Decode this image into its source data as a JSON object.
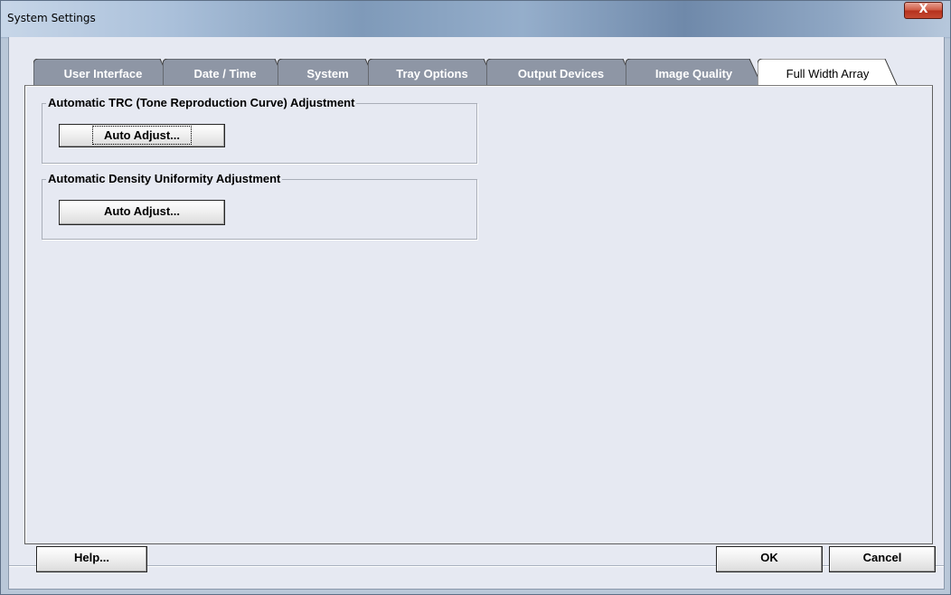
{
  "window": {
    "title": "System Settings",
    "close_icon": "close-icon",
    "close_glyph": "X"
  },
  "tabs": [
    {
      "label": "User Interface",
      "active": false
    },
    {
      "label": "Date / Time",
      "active": false
    },
    {
      "label": "System",
      "active": false
    },
    {
      "label": "Tray Options",
      "active": false
    },
    {
      "label": "Output Devices",
      "active": false
    },
    {
      "label": "Image Quality",
      "active": false
    },
    {
      "label": "Full Width Array",
      "active": true
    }
  ],
  "groups": [
    {
      "title": "Automatic TRC (Tone Reproduction Curve) Adjustment",
      "button_label": "Auto Adjust..."
    },
    {
      "title": "Automatic Density Uniformity Adjustment",
      "button_label": "Auto Adjust..."
    }
  ],
  "footer": {
    "help_label": "Help...",
    "ok_label": "OK",
    "cancel_label": "Cancel"
  },
  "colors": {
    "tab_inactive": "#8e96a5",
    "tab_active": "#ffffff",
    "close_button": "#c44a32"
  }
}
